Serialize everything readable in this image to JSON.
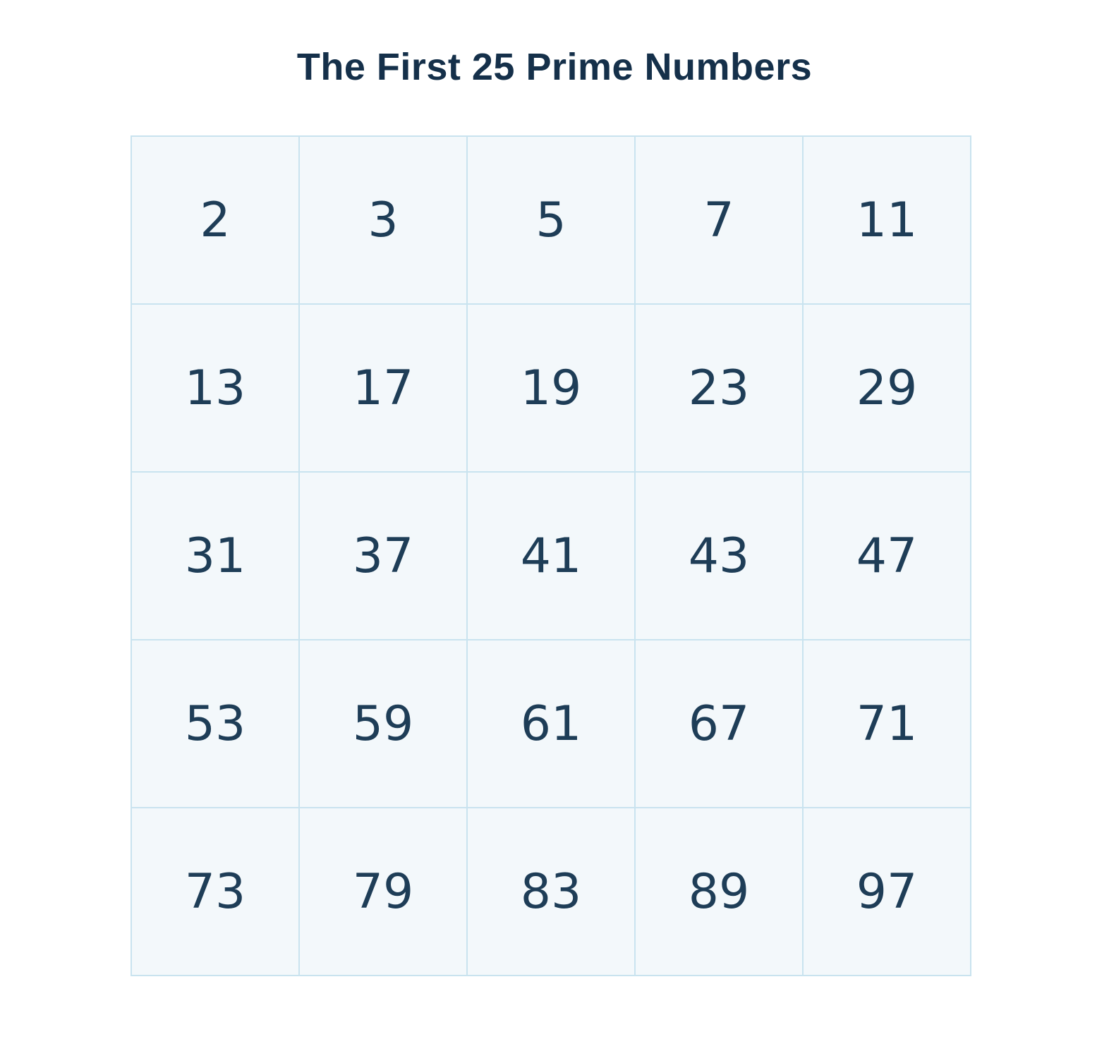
{
  "title": "The First 25 Prime Numbers",
  "primes": [
    "2",
    "3",
    "5",
    "7",
    "11",
    "13",
    "17",
    "19",
    "23",
    "29",
    "31",
    "37",
    "41",
    "43",
    "47",
    "53",
    "59",
    "61",
    "67",
    "71",
    "73",
    "79",
    "83",
    "89",
    "97"
  ],
  "colors": {
    "title": "#15304a",
    "numbers": "#1e3d57",
    "cell_background": "#f3f8fb",
    "grid_lines": "#c9e3ef"
  }
}
